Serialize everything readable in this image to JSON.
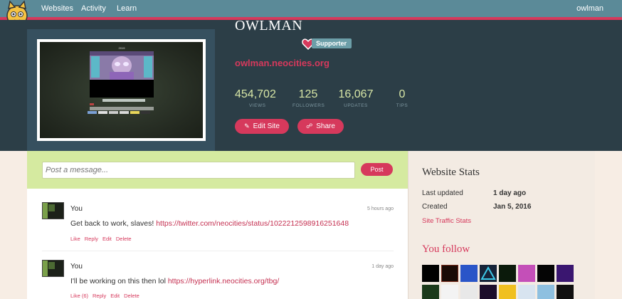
{
  "nav": {
    "links": [
      "Websites",
      "Activity",
      "Learn"
    ],
    "user": "owlman"
  },
  "profile": {
    "name": "OWLMAN",
    "badge": "Supporter",
    "url": "owlman.neocities.org",
    "thumb_year": "2019",
    "stats": [
      {
        "value": "454,702",
        "label": "VIEWS"
      },
      {
        "value": "125",
        "label": "FOLLOWERS"
      },
      {
        "value": "16,067",
        "label": "UPDATES"
      },
      {
        "value": "0",
        "label": "TIPS"
      }
    ],
    "edit_label": "Edit Site",
    "share_label": "Share"
  },
  "composer": {
    "placeholder": "Post a message...",
    "post_label": "Post"
  },
  "feed": [
    {
      "author": "You",
      "time": "5 hours ago",
      "text": "Get back to work, slaves!",
      "link": "https://twitter.com/neocities/status/1022212598916251648",
      "actions": [
        "Like",
        "Reply",
        "Edit",
        "Delete"
      ]
    },
    {
      "author": "You",
      "time": "1 day ago",
      "text": "I'll be working on this then lol",
      "link": "https://hyperlink.neocities.org/tbg/",
      "actions": [
        "Like (6)",
        "Reply",
        "Edit",
        "Delete"
      ]
    }
  ],
  "sidebar": {
    "stats_title": "Website Stats",
    "rows": [
      {
        "key": "Last updated",
        "value": "1 day ago"
      },
      {
        "key": "Created",
        "value": "Jan 5, 2016"
      }
    ],
    "traffic_link": "Site Traffic Stats",
    "follow_title": "You follow"
  },
  "colors": {
    "accent": "#d6395c",
    "nav": "#5b8a98",
    "header": "#2c3e47",
    "post_bar": "#d5eaa0"
  }
}
